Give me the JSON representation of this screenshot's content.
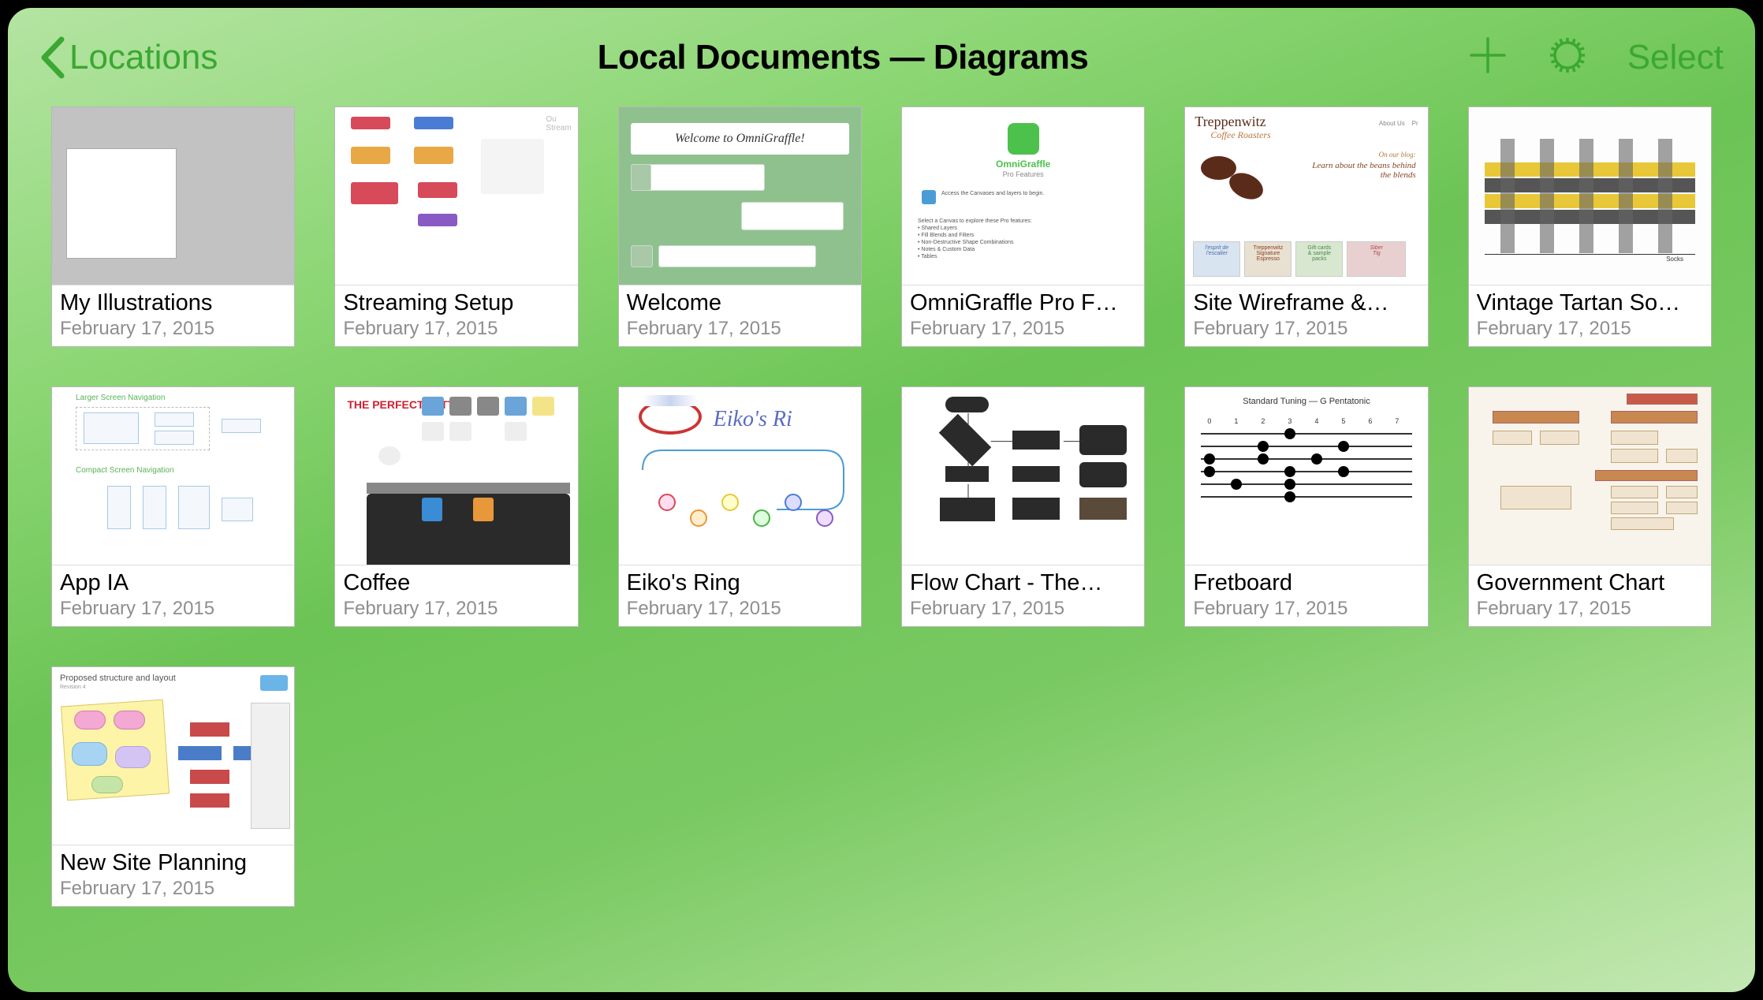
{
  "toolbar": {
    "back_label": "Locations",
    "title": "Local Documents — Diagrams",
    "select_label": "Select"
  },
  "documents": [
    {
      "name": "My Illustrations",
      "date": "February 17, 2015"
    },
    {
      "name": "Streaming Setup",
      "date": "February 17, 2015"
    },
    {
      "name": "Welcome",
      "date": "February 17, 2015"
    },
    {
      "name": "OmniGraffle Pro F…",
      "date": "February 17, 2015"
    },
    {
      "name": "Site Wireframe &…",
      "date": "February 17, 2015"
    },
    {
      "name": "Vintage Tartan So…",
      "date": "February 17, 2015"
    },
    {
      "name": "App IA",
      "date": "February 17, 2015"
    },
    {
      "name": "Coffee",
      "date": "February 17, 2015"
    },
    {
      "name": "Eiko's Ring",
      "date": "February 17, 2015"
    },
    {
      "name": "Flow Chart - The…",
      "date": "February 17, 2015"
    },
    {
      "name": "Fretboard",
      "date": "February 17, 2015"
    },
    {
      "name": "Government Chart",
      "date": "February 17, 2015"
    },
    {
      "name": "New Site Planning",
      "date": "February 17, 2015"
    }
  ],
  "thumb_text": {
    "welcome_banner": "Welcome to OmniGraffle!",
    "pro_title": "OmniGraffle",
    "pro_sub": "Pro Features",
    "wire_title": "Treppenwitz",
    "wire_sub": "Coffee Roasters",
    "wire_blog": "On our blog:",
    "wire_blog2": "Learn about the beans behind the blends",
    "coffee_title": "THE PERFECT LATTE",
    "eiko_title": "Eiko's Ri",
    "fret_title": "Standard Tuning — G Pentatonic",
    "appia_lbl1": "Larger Screen Navigation",
    "appia_lbl2": "Compact Screen Navigation",
    "site_title": "Proposed structure and layout",
    "site_sub": "Revision 4"
  }
}
